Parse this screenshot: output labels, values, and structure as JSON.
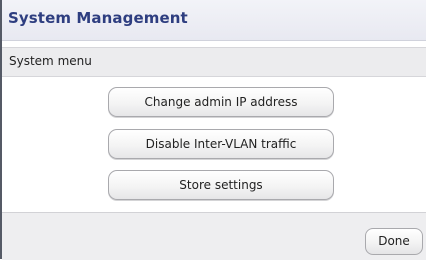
{
  "window": {
    "title": "System Management"
  },
  "menu": {
    "label": "System menu"
  },
  "actions": [
    {
      "label": "Change admin IP address"
    },
    {
      "label": "Disable Inter-VLAN traffic"
    },
    {
      "label": "Store settings"
    }
  ],
  "footer": {
    "done_label": "Done"
  },
  "colors": {
    "title_text": "#2e3e80",
    "title_bar_bg": "#eeeff5",
    "menu_bar_bg": "#ececee",
    "footer_bg": "#eeeef0"
  }
}
